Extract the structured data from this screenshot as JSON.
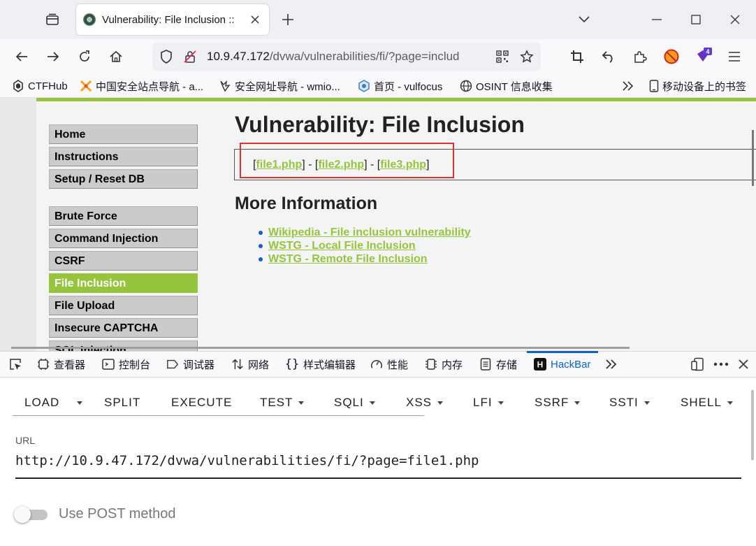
{
  "browser": {
    "tab_title": "Vulnerability: File Inclusion :: ",
    "url_host": "10.9.47.172",
    "url_path": "/dvwa/vulnerabilities/fi/?page=includ",
    "extension_badge": "4"
  },
  "bookmarks": [
    {
      "label": "CTFHub",
      "icon": "ctfhub-icon"
    },
    {
      "label": "中国安全站点导航 - a...",
      "icon": "crossed-swords-icon"
    },
    {
      "label": "安全网址导航 - wmio...",
      "icon": "wolf-icon"
    },
    {
      "label": "首页 - vulfocus",
      "icon": "shield-icon"
    },
    {
      "label": "OSINT 信息收集",
      "icon": "globe-icon"
    },
    {
      "label": "移动设备上的书签",
      "icon": "mobile-icon"
    }
  ],
  "dvwa": {
    "heading": "Vulnerability: File Inclusion",
    "menu_top": [
      "Home",
      "Instructions",
      "Setup / Reset DB"
    ],
    "menu_vulns": [
      "Brute Force",
      "Command Injection",
      "CSRF",
      "File Inclusion",
      "File Upload",
      "Insecure CAPTCHA",
      "SQL Injection"
    ],
    "active_item": "File Inclusion",
    "file_links": [
      "file1.php",
      "file2.php",
      "file3.php"
    ],
    "more_info_heading": "More Information",
    "more_info_links": [
      "Wikipedia - File inclusion vulnerability",
      "WSTG - Local File Inclusion",
      "WSTG - Remote File Inclusion"
    ]
  },
  "devtools": {
    "tabs": [
      "查看器",
      "控制台",
      "调试器",
      "网络",
      "样式编辑器",
      "性能",
      "内存",
      "存储",
      "HackBar"
    ],
    "selected": "HackBar"
  },
  "hackbar": {
    "buttons": [
      "LOAD",
      "SPLIT",
      "EXECUTE",
      "TEST",
      "SQLI",
      "XSS",
      "LFI",
      "SSRF",
      "SSTI",
      "SHELL"
    ],
    "url_label": "URL",
    "url_value": "http://10.9.47.172/dvwa/vulnerabilities/fi/?page=file1.php",
    "post_label": "Use POST method",
    "post_enabled": false
  },
  "colors": {
    "dvwa_green": "#95c53d",
    "highlight_red": "#e03030",
    "devtools_blue": "#0a62d0"
  }
}
